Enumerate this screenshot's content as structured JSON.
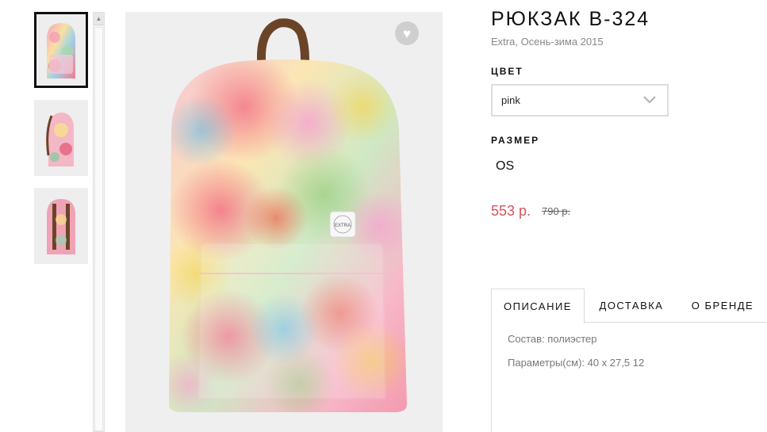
{
  "product": {
    "title": "РЮКЗАК B-324",
    "subtitle": "Extra, Осень-зима 2015",
    "color_label": "ЦВЕТ",
    "color_value": "pink",
    "size_label": "РАЗМЕР",
    "size_value": "OS",
    "price": "553 р.",
    "old_price": "790 р.",
    "brand_patch": "EXTRA"
  },
  "tabs": [
    {
      "label": "ОПИСАНИЕ",
      "active": true
    },
    {
      "label": "ДОСТАВКА",
      "active": false
    },
    {
      "label": "О БРЕНДЕ",
      "active": false
    }
  ],
  "description": {
    "line1": "Состав: полиэстер",
    "line2": "Параметры(см): 40 x 27,5 12"
  },
  "icons": {
    "favorite": "heart-icon",
    "select": "chevron-down-icon",
    "scroll": "arrow-up-icon"
  },
  "colors": {
    "price": "#d9535b",
    "accent": "#111111",
    "strap": "#6b4428"
  }
}
